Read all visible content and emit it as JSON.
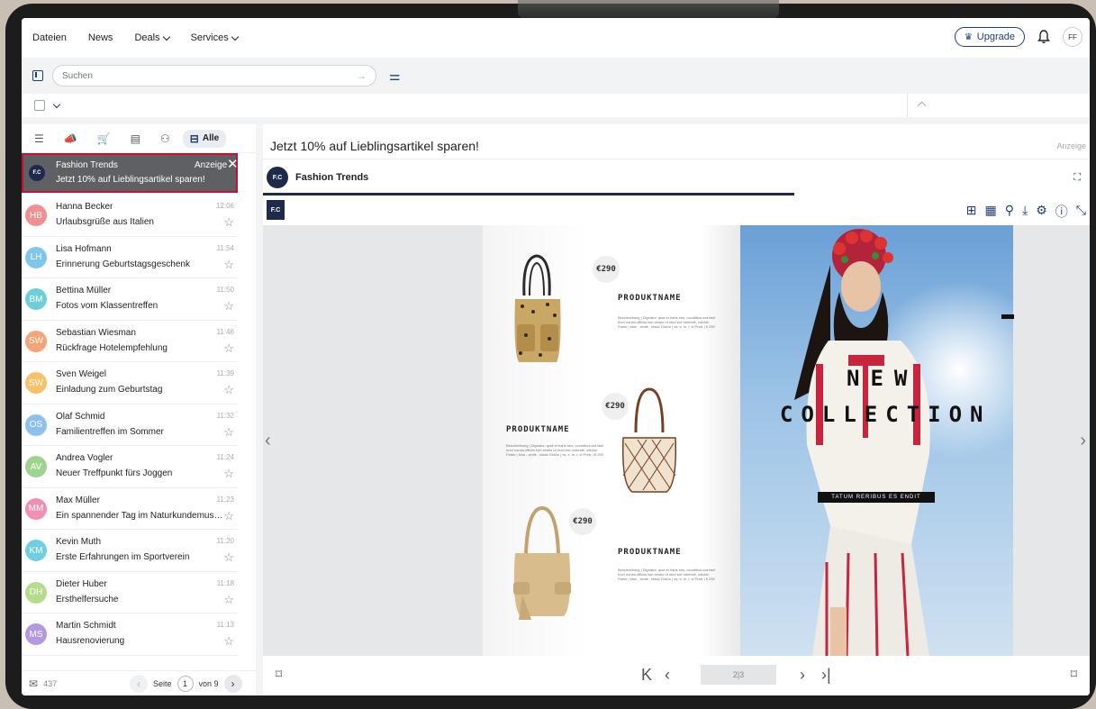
{
  "nav": {
    "items": [
      {
        "label": "Dateien",
        "has_dropdown": false
      },
      {
        "label": "News",
        "has_dropdown": false
      },
      {
        "label": "Deals",
        "has_dropdown": true
      },
      {
        "label": "Services",
        "has_dropdown": true
      }
    ],
    "upgrade_label": "Upgrade",
    "avatar_initials": "FF"
  },
  "search": {
    "placeholder": "Suchen"
  },
  "filters": {
    "all_label": "Alle"
  },
  "ad": {
    "sender": "Fashion Trends",
    "subject": "Jetzt 10% auf Lieblingsartikel sparen!",
    "label": "Anzeige",
    "logo_text": "F.C"
  },
  "mails": [
    {
      "initials": "HB",
      "color": "#ef8f8f",
      "sender": "Hanna Becker",
      "subject": "Urlaubsgrüße aus Italien",
      "time": "12:06"
    },
    {
      "initials": "LH",
      "color": "#7fc6ea",
      "sender": "Lisa Hofmann",
      "subject": "Erinnerung Geburtstagsgeschenk",
      "time": "11:54"
    },
    {
      "initials": "BM",
      "color": "#6fcfd6",
      "sender": "Bettina Müller",
      "subject": "Fotos vom Klassentreffen",
      "time": "11:50"
    },
    {
      "initials": "SW",
      "color": "#f5a47a",
      "sender": "Sebastian Wiesman",
      "subject": "Rückfrage Hotelempfehlung",
      "time": "11:46"
    },
    {
      "initials": "SW",
      "color": "#f8c16a",
      "sender": "Sven Weigel",
      "subject": "Einladung zum Geburtstag",
      "time": "11:39"
    },
    {
      "initials": "OS",
      "color": "#8fbfef",
      "sender": "Olaf Schmid",
      "subject": "Familientreffen im Sommer",
      "time": "11:32"
    },
    {
      "initials": "AV",
      "color": "#9ed48f",
      "sender": "Andrea Vogler",
      "subject": "Neuer Treffpunkt fürs Joggen",
      "time": "11:24"
    },
    {
      "initials": "MM",
      "color": "#ef8fb3",
      "sender": "Max Müller",
      "subject": "Ein spannender Tag im Naturkundemuseum",
      "time": "11:23"
    },
    {
      "initials": "KM",
      "color": "#6fcfe0",
      "sender": "Kevin Muth",
      "subject": "Erste Erfahrungen im Sportverein",
      "time": "11:20"
    },
    {
      "initials": "DH",
      "color": "#b5dc8a",
      "sender": "Dieter Huber",
      "subject": "Ersthelfersuche",
      "time": "11:18"
    },
    {
      "initials": "MS",
      "color": "#b39ae0",
      "sender": "Martin Schmidt",
      "subject": "Hausrenovierung",
      "time": "11:13"
    }
  ],
  "footer": {
    "count": "437",
    "page_label": "Seite",
    "page_current": "1",
    "page_total": "von 9"
  },
  "pane": {
    "subject": "Jetzt 10% auf Lieblingsartikel sparen!",
    "anzeige": "Anzeige",
    "sender": "Fashion Trends",
    "logo_text": "F.C"
  },
  "catalog": {
    "products": [
      {
        "price": "€290",
        "name": "PRODUKTNAME",
        "desc": "Beschreibung | Dignatur, quia et haris nes, occatibus aut facil eum nonsa officiis ium sentio ut mod ere dolendit, odictat. Farbe | blue , white , black Größe | xs, s, m, l, xl Preis | € 290"
      },
      {
        "price": "€290",
        "name": "PRODUKTNAME",
        "desc": "Beschreibung | Dignatur, quia et haris nes, occatibus aut facil eum nonsa officiis ium sentio ut mod ere dolendit, odictat. Farbe | blue , white , black Größe | xs, s, m, l, xl Preis | € 290"
      },
      {
        "price": "€290",
        "name": "PRODUKTNAME",
        "desc": "Beschreibung | Dignatur, quia et haris nes, occatibus aut facil eum nonsa officiis ium sentio ut mod ere dolendit, odictat. Farbe | blue , white , black Größe | xs, s, m, l, xl Preis | € 290"
      }
    ],
    "headline_1": "NEW",
    "headline_2": "COLLECTION",
    "tagline": "TATUM RERIBUS ES ENDIT",
    "page_indicator": "2|3"
  }
}
